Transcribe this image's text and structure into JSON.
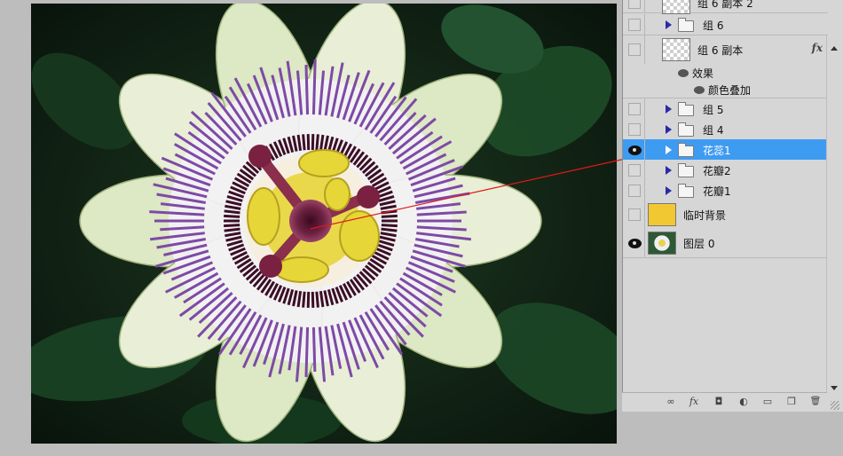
{
  "layers_panel": {
    "rows": [
      {
        "name": "组 6 副本 2",
        "visible": false,
        "kind": "layer-checker",
        "selected": false
      },
      {
        "name": "组 6",
        "visible": false,
        "kind": "group",
        "selected": false
      },
      {
        "name": "组 6 副本",
        "visible": false,
        "kind": "layer-checker",
        "selected": false,
        "fx": "fx"
      },
      {
        "name": "效果",
        "kind": "effects-header"
      },
      {
        "name": "颜色叠加",
        "kind": "effect"
      },
      {
        "name": "组 5",
        "visible": false,
        "kind": "group",
        "selected": false
      },
      {
        "name": "组 4",
        "visible": false,
        "kind": "group",
        "selected": false
      },
      {
        "name": "花蕊1",
        "visible": true,
        "kind": "group",
        "selected": true
      },
      {
        "name": "花瓣2",
        "visible": false,
        "kind": "group",
        "selected": false
      },
      {
        "name": "花瓣1",
        "visible": false,
        "kind": "group",
        "selected": false
      },
      {
        "name": "临时背景",
        "visible": false,
        "kind": "layer-solid",
        "selected": false,
        "swatch": "#f2c832"
      },
      {
        "name": "图层 0",
        "visible": true,
        "kind": "layer-photo",
        "selected": false
      }
    ],
    "toolbar_icons": [
      "link-icon",
      "fx-icon",
      "mask-icon",
      "adjustment-icon",
      "new-group-icon",
      "new-layer-icon",
      "trash-icon"
    ],
    "toolbar_glyphs": {
      "link": "∞",
      "fx": "fx",
      "mask": "◘",
      "adjustment": "◐",
      "group": "▭",
      "new": "❐",
      "trash": "🗑"
    }
  },
  "annotation": {
    "color": "#e01818"
  },
  "colors": {
    "selection": "#3e9bf2",
    "panel": "#d6d6d6",
    "background": "#bdbdbd"
  }
}
